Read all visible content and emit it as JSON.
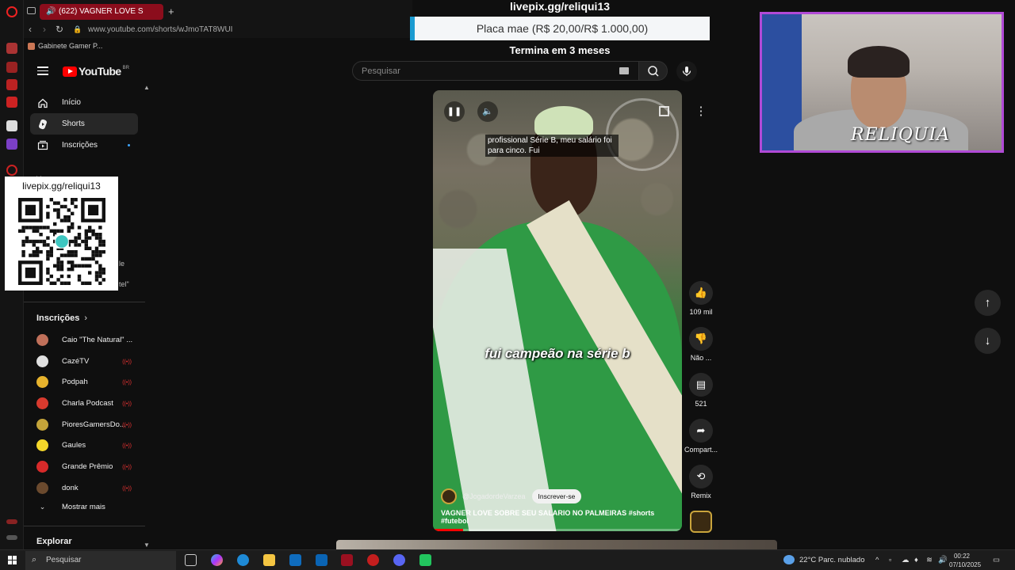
{
  "browser": {
    "tab_title": "(622) VAGNER LOVE S",
    "new_tab": "+",
    "url": "www.youtube.com/shorts/wJmoTAT8WUI",
    "bookmark": "Gabinete Gamer P..."
  },
  "youtube": {
    "logo_text": "YouTube",
    "country": "BR",
    "nav": [
      {
        "label": "Início",
        "icon": "home-icon"
      },
      {
        "label": "Shorts",
        "icon": "shorts-icon"
      },
      {
        "label": "Inscrições",
        "icon": "subscriptions-icon"
      }
    ],
    "peek_labels": [
      "Vo",
      "le",
      "tel\""
    ],
    "subscriptions_header": "Inscrições",
    "subscriptions": [
      {
        "name": "Caio \"The Natural\" ...",
        "color": "#c0705a"
      },
      {
        "name": "CazéTV",
        "color": "#e0e0e0"
      },
      {
        "name": "Podpah",
        "color": "#e7b32d"
      },
      {
        "name": "Charla Podcast",
        "color": "#d83a2e"
      },
      {
        "name": "PioresGamersDo...",
        "color": "#c4a43a"
      },
      {
        "name": "Gaules",
        "color": "#f4d72a"
      },
      {
        "name": "Grande Prêmio",
        "color": "#d82a2a"
      },
      {
        "name": "donk",
        "color": "#6b4a2e"
      }
    ],
    "show_more": "Mostrar mais",
    "explore": "Explorar",
    "search_placeholder": "Pesquisar"
  },
  "overlay": {
    "qr_title": "livepix.gg/reliqui13",
    "donation_title": "livepix.gg/reliqui13",
    "donation_goal": "Placa mae (R$ 20,00/R$ 1.000,00)",
    "donation_progress": 0.02,
    "donation_ends": "Termina em 3 meses",
    "streamer_name": "RELIQUIA"
  },
  "short": {
    "caption_top": "profissional Série B, meu salário foi para cinco. Fui",
    "caption_mid": "fui campeão na série b",
    "channel": "@JogadordeVarzea",
    "subscribe": "Inscrever-se",
    "title": "VAGNER LOVE SOBRE SEU SALARIO NO PALMEIRAS #shorts #futebol",
    "progress": 0.12,
    "actions": {
      "likes": "109 mil",
      "dislike": "Não ...",
      "comments": "521",
      "share": "Compart...",
      "remix": "Remix"
    }
  },
  "taskbar": {
    "search": "Pesquisar",
    "weather": "22°C  Parc. nublado",
    "time": "00:22",
    "date": "07/10/2025"
  }
}
